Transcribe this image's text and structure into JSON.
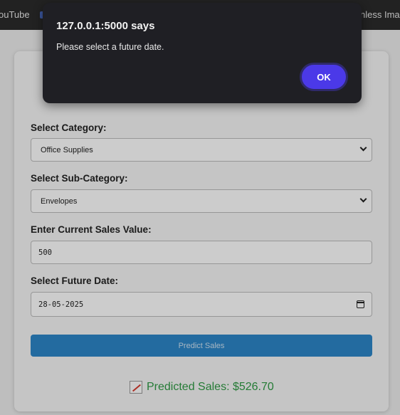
{
  "bookmarks": {
    "left_label": "ouTube",
    "right_label": "nless Imag"
  },
  "form": {
    "category_label": "Select Category:",
    "category_value": "Office Supplies",
    "subcategory_label": "Select Sub-Category:",
    "subcategory_value": "Envelopes",
    "sales_label": "Enter Current Sales Value:",
    "sales_value": "500",
    "date_label": "Select Future Date:",
    "date_value": "28-05-2025",
    "predict_button": "Predict Sales"
  },
  "result": {
    "icon": "chart-increasing-icon",
    "text": "Predicted Sales: $526.70"
  },
  "dialog": {
    "title": "127.0.0.1:5000 says",
    "message": "Please select a future date.",
    "ok_label": "OK"
  },
  "colors": {
    "ok_button": "#4b39e8",
    "predict_button": "#2c86c9",
    "result_text": "#2f9a44",
    "dialog_bg": "#1f1f24"
  }
}
